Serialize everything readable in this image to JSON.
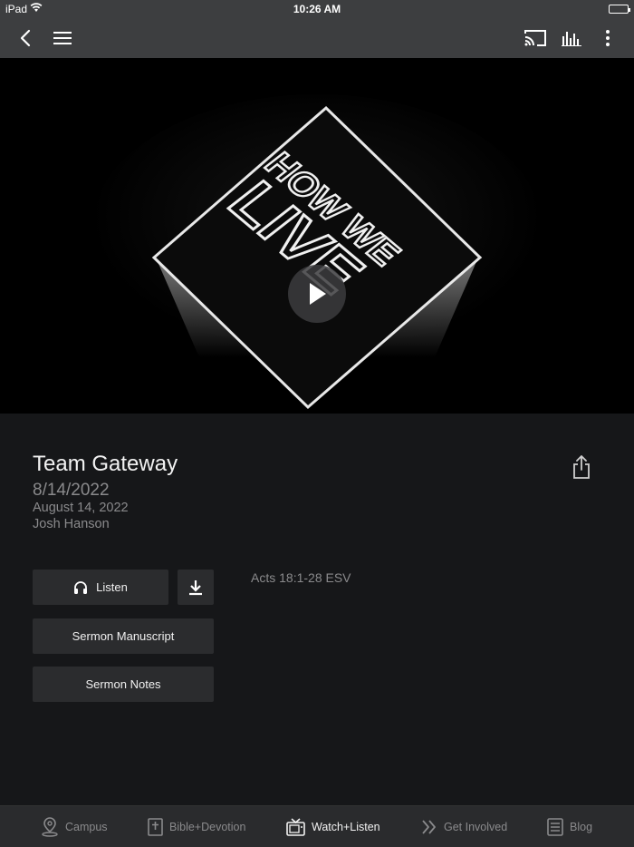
{
  "status_bar": {
    "device": "iPad",
    "time": "10:26 AM"
  },
  "header": {
    "icons": [
      "back-chevron-icon",
      "hamburger-menu-icon",
      "cast-icon",
      "equalizer-icon",
      "more-vertical-icon"
    ]
  },
  "video": {
    "artwork_lines": [
      "HOW WE",
      "LIVE"
    ]
  },
  "sermon": {
    "title": "Team Gateway",
    "date_short": "8/14/2022",
    "date_long": "August 14, 2022",
    "speaker": "Josh Hanson",
    "scripture": "Acts 18:1-28 ESV"
  },
  "buttons": {
    "listen": "Listen",
    "manuscript": "Sermon Manuscript",
    "notes": "Sermon Notes"
  },
  "tabs": [
    {
      "label": "Campus",
      "icon": "location-pin-icon"
    },
    {
      "label": "Bible+Devotion",
      "icon": "bible-icon"
    },
    {
      "label": "Watch+Listen",
      "icon": "tv-icon",
      "active": true
    },
    {
      "label": "Get Involved",
      "icon": "double-chevron-icon"
    },
    {
      "label": "Blog",
      "icon": "document-icon"
    }
  ],
  "colors": {
    "bar": "#3d3e40",
    "content_bg": "#161719",
    "button_bg": "#2b2c2e",
    "muted_text": "#8a8a8c",
    "tab_bar": "#2a2b2d"
  }
}
